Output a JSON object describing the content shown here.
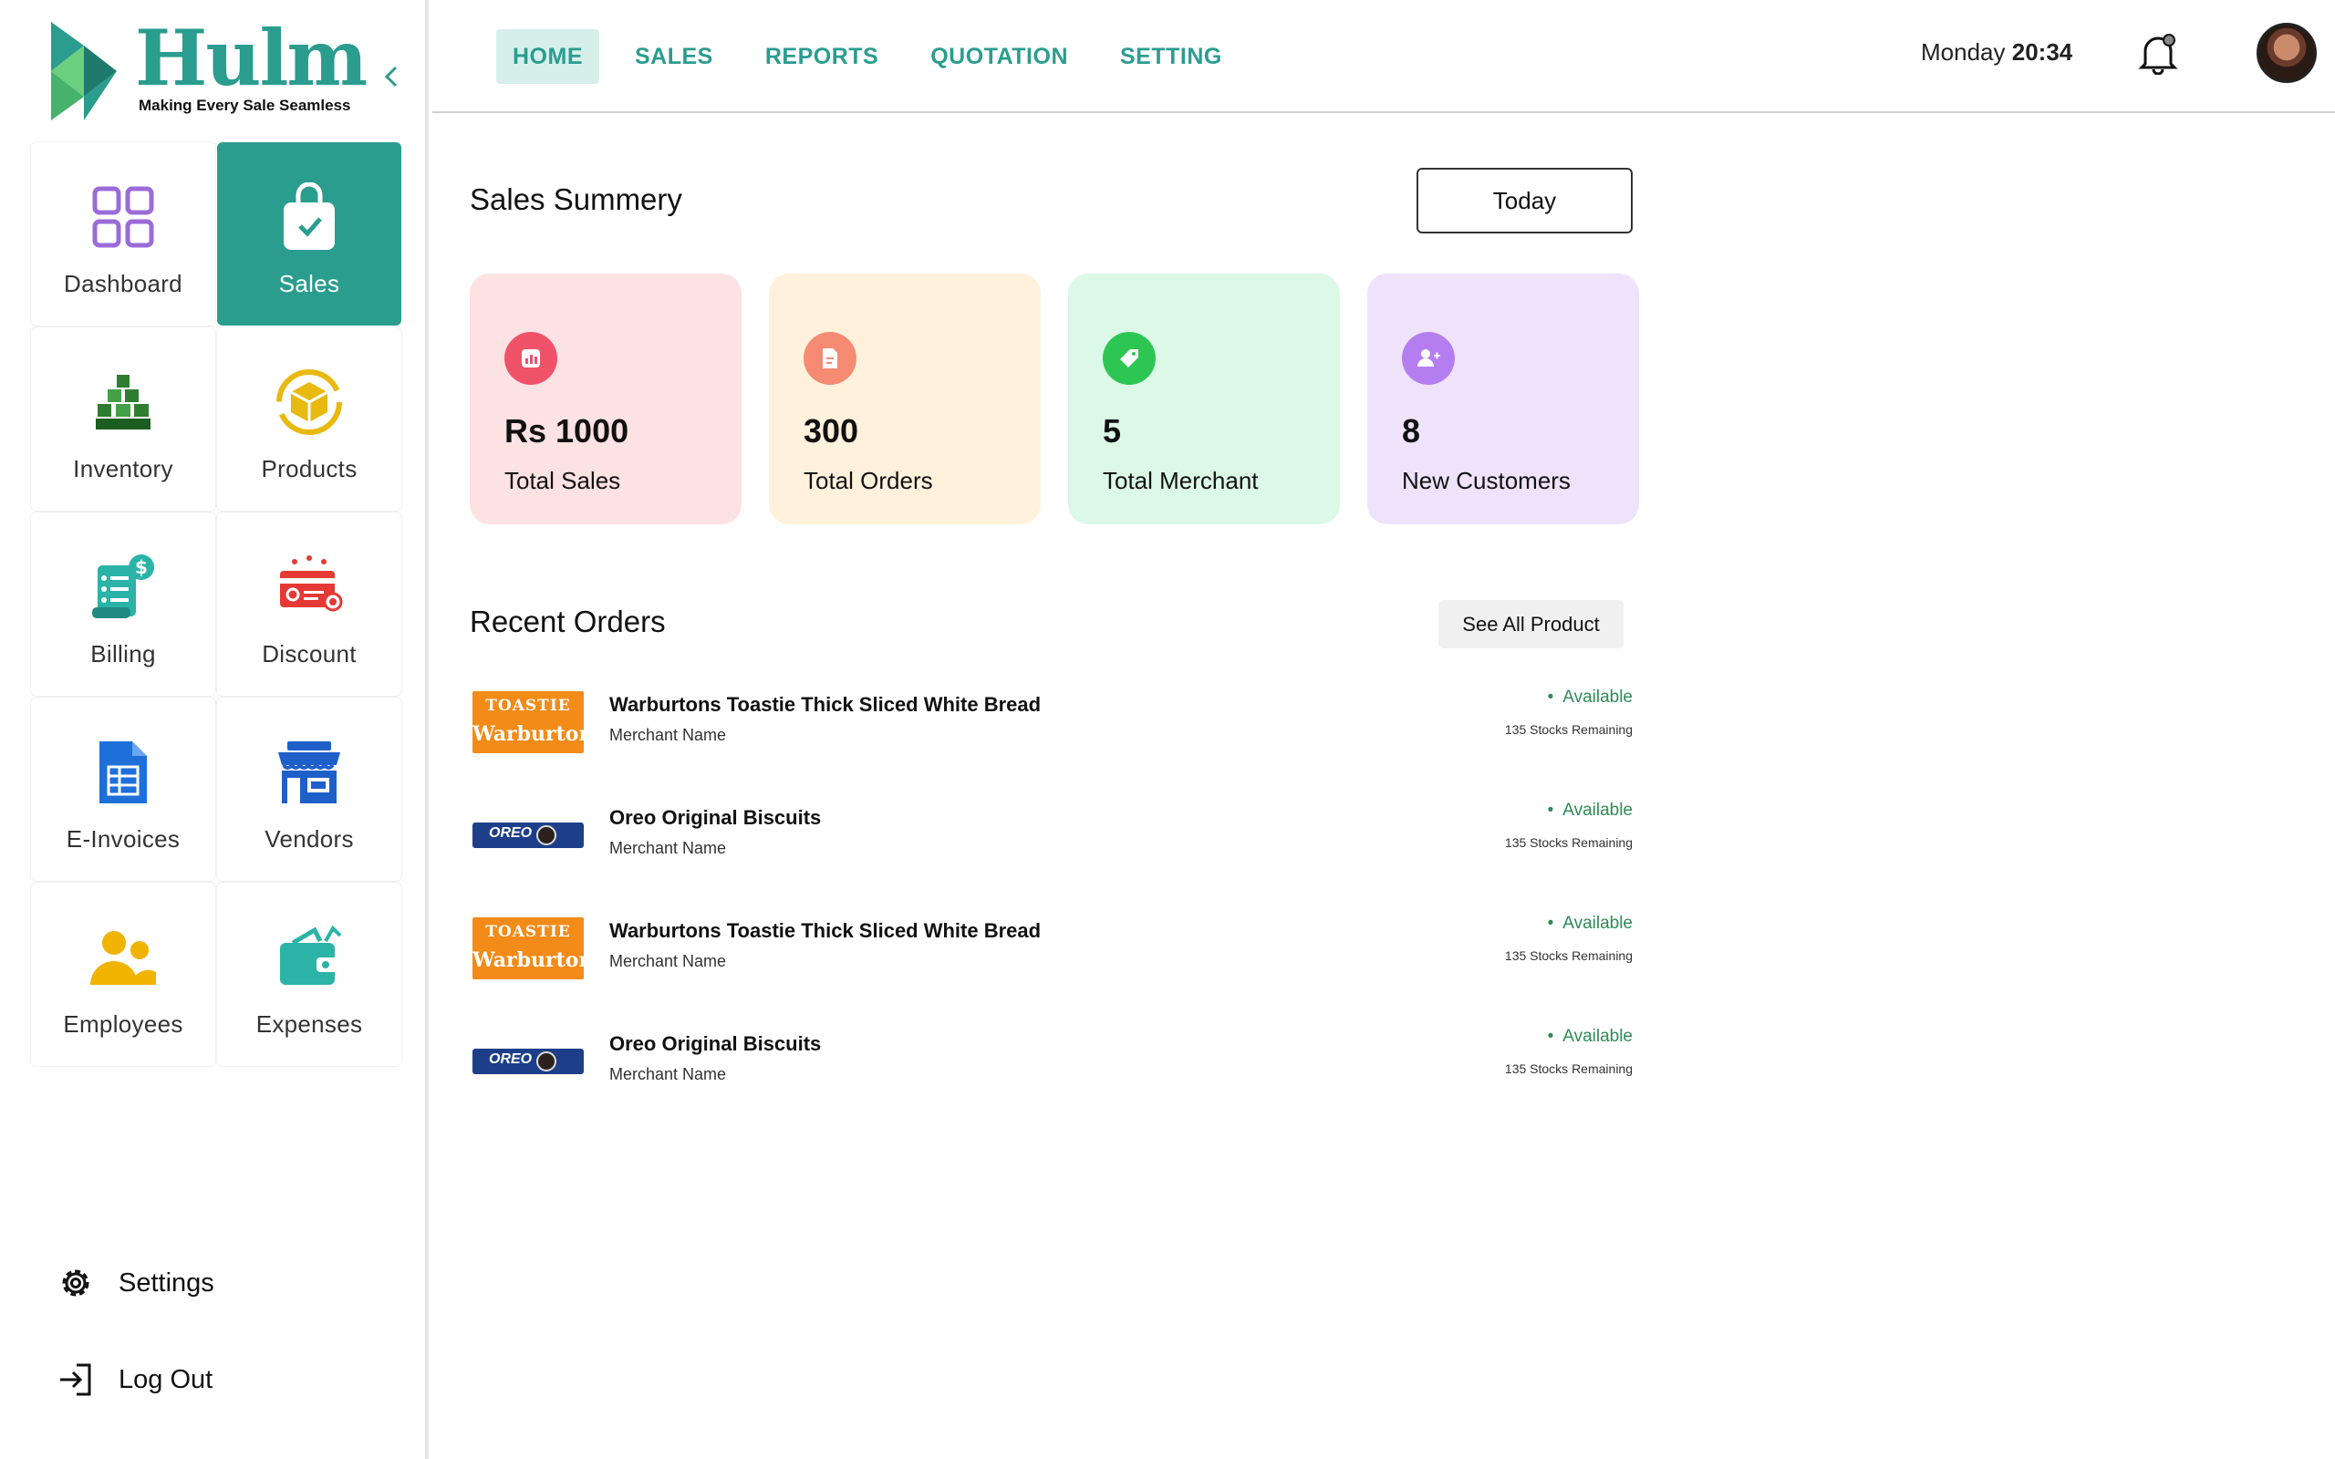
{
  "brand": {
    "name": "Hulm",
    "tagline": "Making Every Sale Seamless",
    "accent_color": "#2a9d8f"
  },
  "sidebar": {
    "tiles": [
      {
        "label": "Dashboard",
        "icon": "dashboard-grid-icon",
        "active": false
      },
      {
        "label": "Sales",
        "icon": "shopping-bag-icon",
        "active": true
      },
      {
        "label": "Inventory",
        "icon": "stacked-boxes-icon",
        "active": false
      },
      {
        "label": "Products",
        "icon": "product-box-icon",
        "active": false
      },
      {
        "label": "Billing",
        "icon": "bill-receipt-icon",
        "active": false
      },
      {
        "label": "Discount",
        "icon": "discount-card-icon",
        "active": false
      },
      {
        "label": "E-Invoices",
        "icon": "invoice-document-icon",
        "active": false
      },
      {
        "label": "Vendors",
        "icon": "storefront-icon",
        "active": false
      },
      {
        "label": "Employees",
        "icon": "people-icon",
        "active": false
      },
      {
        "label": "Expenses",
        "icon": "wallet-icon",
        "active": false
      }
    ],
    "settings_label": "Settings",
    "logout_label": "Log Out"
  },
  "topnav": {
    "items": [
      {
        "label": "HOME",
        "active": true
      },
      {
        "label": "SALES",
        "active": false
      },
      {
        "label": "REPORTS",
        "active": false
      },
      {
        "label": "QUOTATION",
        "active": false
      },
      {
        "label": "SETTING",
        "active": false
      }
    ],
    "day": "Monday",
    "time": "20:34"
  },
  "summary": {
    "title": "Sales Summery",
    "filter_label": "Today",
    "cards": [
      {
        "value": "Rs 1000",
        "label": "Total Sales",
        "bg": "#fde2e4",
        "icon_bg": "#f0526a",
        "icon": "bar-chart-icon"
      },
      {
        "value": "300",
        "label": "Total Orders",
        "bg": "#fff1dc",
        "icon_bg": "#f58b72",
        "icon": "document-icon"
      },
      {
        "value": "5",
        "label": "Total Merchant",
        "bg": "#dcf8e6",
        "icon_bg": "#2dc653",
        "icon": "tag-icon"
      },
      {
        "value": "8",
        "label": "New Customers",
        "bg": "#efe3fc",
        "icon_bg": "#b57ef0",
        "icon": "add-user-icon"
      }
    ]
  },
  "recent": {
    "title": "Recent Orders",
    "see_all_label": "See All Product",
    "orders": [
      {
        "name": "Warburtons Toastie Thick Sliced White Bread",
        "merchant": "Merchant Name",
        "status": "Available",
        "stock": "135 Stocks Remaining",
        "thumb": "toastie"
      },
      {
        "name": "Oreo Original Biscuits",
        "merchant": "Merchant Name",
        "status": "Available",
        "stock": "135 Stocks Remaining",
        "thumb": "oreo"
      },
      {
        "name": "Warburtons Toastie Thick Sliced White Bread",
        "merchant": "Merchant Name",
        "status": "Available",
        "stock": "135 Stocks Remaining",
        "thumb": "toastie"
      },
      {
        "name": "Oreo Original Biscuits",
        "merchant": "Merchant Name",
        "status": "Available",
        "stock": "135 Stocks Remaining",
        "thumb": "oreo"
      }
    ],
    "thumb_text": {
      "toastie_top": "TOASTIE",
      "toastie_brand": "Warburtons",
      "oreo_brand": "OREO"
    }
  }
}
